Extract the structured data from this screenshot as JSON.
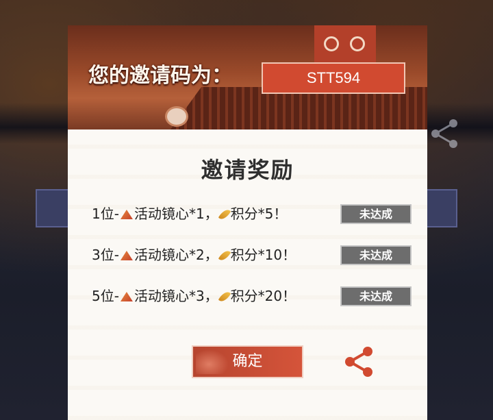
{
  "dialog": {
    "invite_label": "您的邀请码为：",
    "invite_code": "STT594",
    "title": "邀请奖励",
    "rewards": [
      {
        "prefix": "1位-",
        "item1": "活动镜心*1，",
        "item2": "积分*5！",
        "status": "未达成"
      },
      {
        "prefix": "3位-",
        "item1": "活动镜心*2，",
        "item2": "积分*10！",
        "status": "未达成"
      },
      {
        "prefix": "5位-",
        "item1": "活动镜心*3，",
        "item2": "积分*20！",
        "status": "未达成"
      }
    ],
    "confirm_label": "确定"
  },
  "icons": {
    "mirror": "mirror-heart-icon",
    "points": "feather-points-icon",
    "share": "share-icon"
  },
  "colors": {
    "accent": "#d14a30",
    "badge_gray": "#6d6d6d",
    "share_red": "#d14a30"
  }
}
